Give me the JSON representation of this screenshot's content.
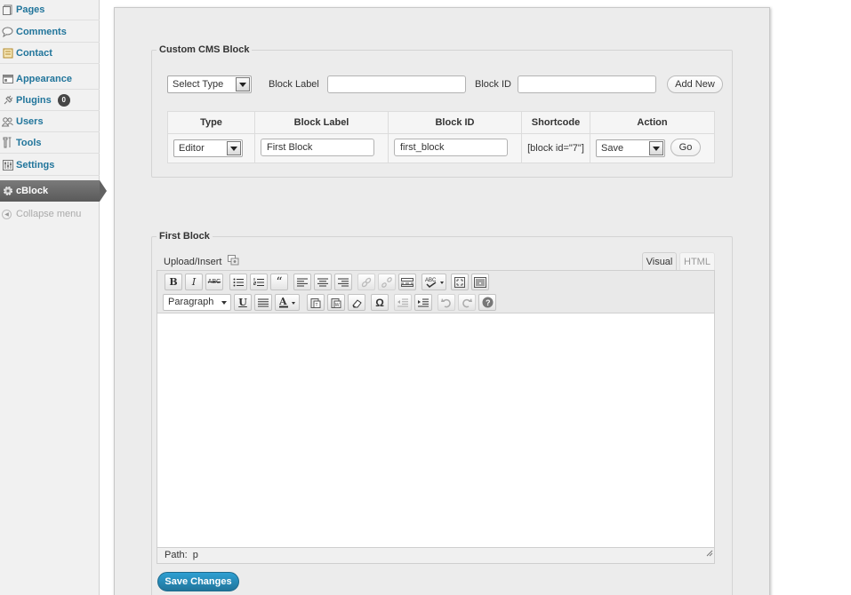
{
  "sidebar": {
    "items": [
      {
        "label": "Pages",
        "icon": "pages-icon"
      },
      {
        "label": "Comments",
        "icon": "comments-icon"
      },
      {
        "label": "Contact",
        "icon": "contact-icon"
      },
      {
        "label": "Appearance",
        "icon": "appearance-icon"
      },
      {
        "label": "Plugins",
        "icon": "plugins-icon",
        "badge": "0"
      },
      {
        "label": "Users",
        "icon": "users-icon"
      },
      {
        "label": "Tools",
        "icon": "tools-icon"
      },
      {
        "label": "Settings",
        "icon": "settings-icon"
      },
      {
        "label": "cBlock",
        "icon": "cblock-gear-icon",
        "current": true
      }
    ],
    "collapse_label": "Collapse menu"
  },
  "cms_block": {
    "legend": "Custom CMS Block",
    "type_select": "Select Type",
    "block_label_label": "Block Label",
    "block_label_value": "",
    "block_id_label": "Block ID",
    "block_id_value": "",
    "add_new_label": "Add New",
    "table": {
      "headers": [
        "Type",
        "Block Label",
        "Block ID",
        "Shortcode",
        "Action"
      ],
      "rows": [
        {
          "type": "Editor",
          "label": "First Block",
          "id": "first_block",
          "shortcode": "[block id=\"7\"]",
          "action": "Save",
          "go": "Go"
        }
      ]
    }
  },
  "editor": {
    "legend": "First Block",
    "upload_label": "Upload/Insert",
    "tab_visual": "Visual",
    "tab_html": "HTML",
    "format_select": "Paragraph",
    "path_label": "Path:",
    "path_value": "p",
    "save_label": "Save Changes",
    "buttons_row1": [
      "bold-icon",
      "italic-icon",
      "strikethrough-icon",
      "bullet-list-icon",
      "numbered-list-icon",
      "blockquote-icon",
      "align-left-icon",
      "align-center-icon",
      "align-right-icon",
      "insert-link-icon",
      "unlink-icon",
      "insert-more-icon",
      "spellcheck-icon",
      "fullscreen-icon",
      "kitchen-sink-icon"
    ],
    "buttons_row2": [
      "underline-icon",
      "justify-icon",
      "text-color-icon",
      "paste-text-icon",
      "paste-word-icon",
      "remove-format-icon",
      "special-character-icon",
      "outdent-icon",
      "indent-icon",
      "undo-icon",
      "redo-icon",
      "help-icon"
    ]
  },
  "colors": {
    "link": "#21759b",
    "primary_button": "#21759b",
    "panel_bg": "#ececec"
  }
}
